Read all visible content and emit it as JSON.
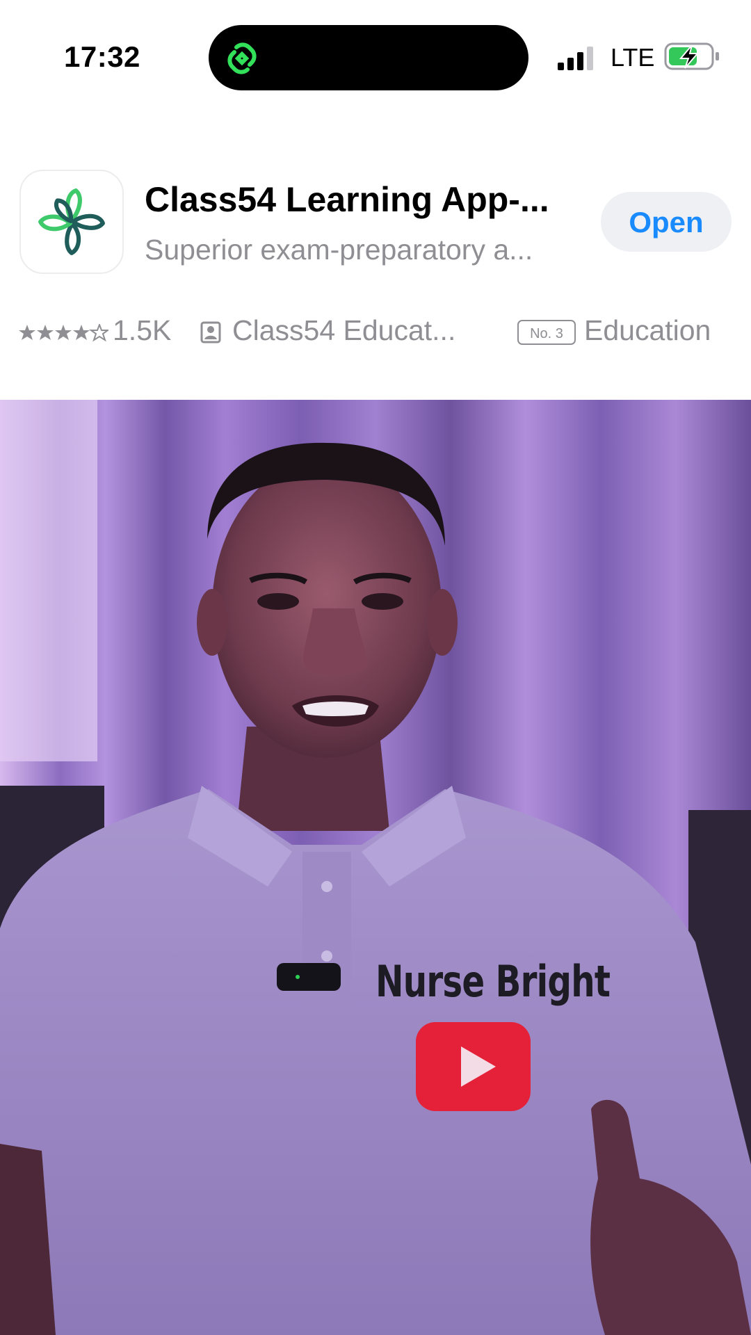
{
  "status_bar": {
    "time": "17:32",
    "network": "LTE",
    "icons": [
      "link-icon",
      "signal-icon",
      "battery-charging-icon"
    ]
  },
  "app_banner": {
    "title": "Class54 Learning App-...",
    "subtitle": "Superior exam-preparatory a...",
    "open_label": "Open",
    "rating_count": "1.5K",
    "rating_stars": 4,
    "developer": "Class54 Educat...",
    "rank": "No. 3",
    "category": "Education",
    "accent_color": "#1a8bff",
    "icon": "flower-logo-icon"
  },
  "video": {
    "shirt_text": "Nurse Bright",
    "logo_icon": "youtube-play-icon"
  }
}
